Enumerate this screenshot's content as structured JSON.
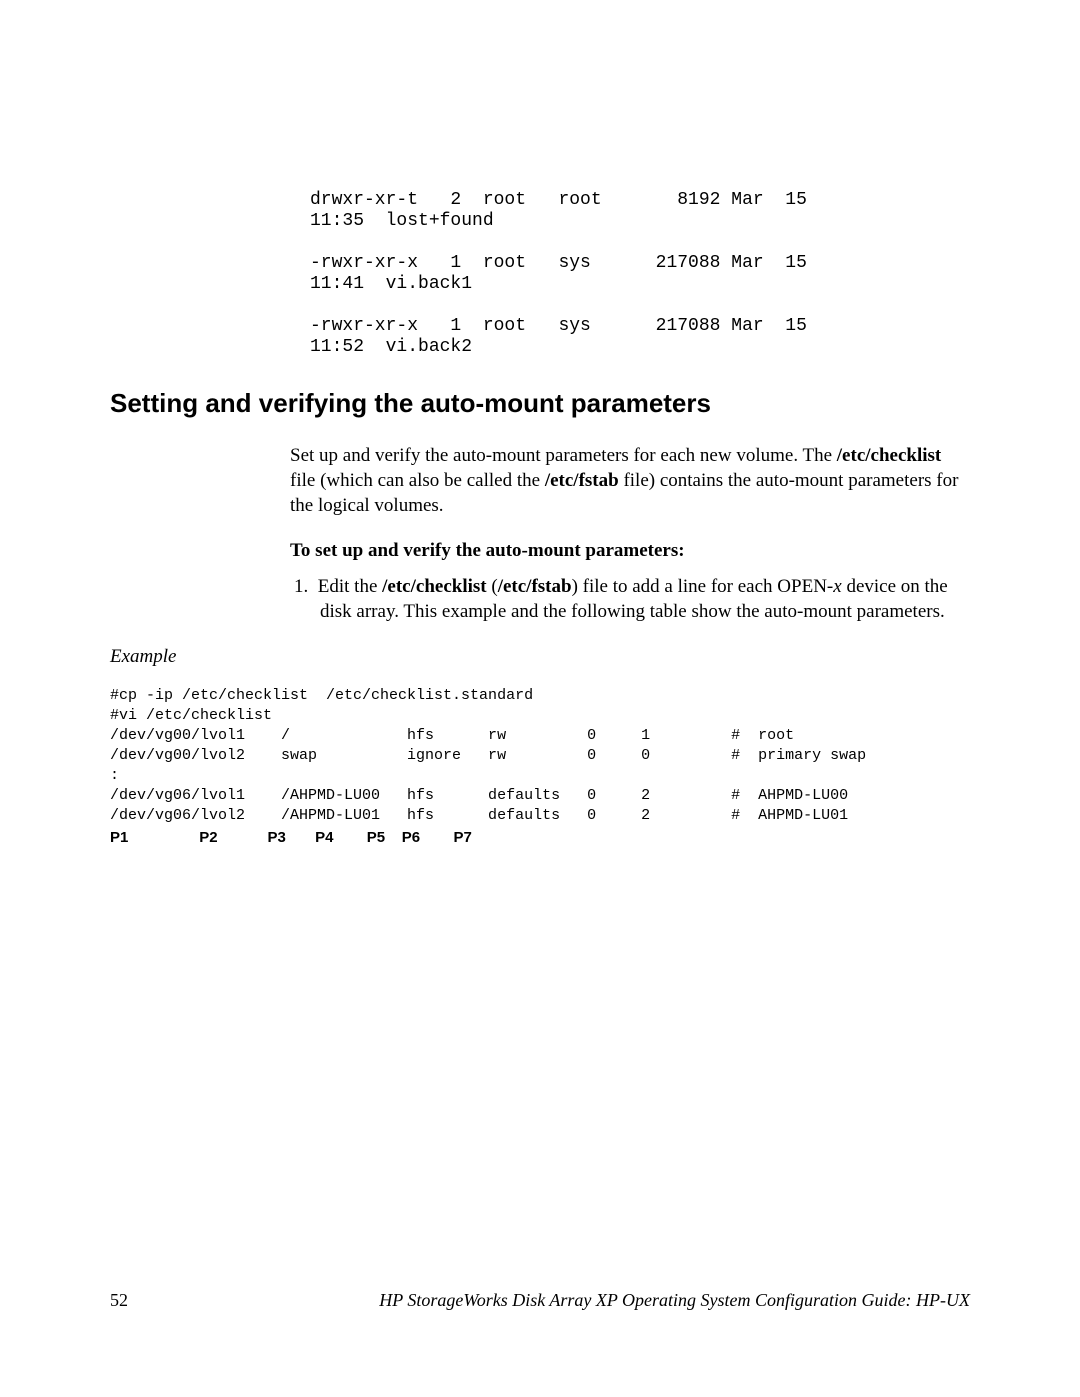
{
  "ls_output": "drwxr-xr-t   2  root   root       8192 Mar  15\n11:35  lost+found\n\n-rwxr-xr-x   1  root   sys      217088 Mar  15\n11:41  vi.back1\n\n-rwxr-xr-x   1  root   sys      217088 Mar  15\n11:52  vi.back2",
  "heading": "Setting and verifying the auto-mount parameters",
  "para_pre": "Set up and verify the auto-mount parameters for each new volume. The ",
  "para_b1": "/etc/checklist",
  "para_mid": " file (which can also be called the ",
  "para_b2": "/etc/fstab",
  "para_post": " file) contains the auto-mount parameters for the logical volumes.",
  "subhead": "To set up and verify the auto-mount parameters:",
  "step1_num": "1.",
  "step1_t1": "Edit the ",
  "step1_b1": "/etc/checklist",
  "step1_t2": " (",
  "step1_b2": "/etc/fstab",
  "step1_t3": ") file to add a line for each OPEN-",
  "step1_i1": "x",
  "step1_t4": " device on the disk array. This example and the following table show the auto-mount parameters.",
  "example_label": "Example",
  "checklist_text": "#cp -ip /etc/checklist  /etc/checklist.standard\n#vi /etc/checklist\n/dev/vg00/lvol1    /             hfs      rw         0     1         #  root\n/dev/vg00/lvol2    swap          ignore   rw         0     0         #  primary swap\n:\n/dev/vg06/lvol1    /AHPMD-LU00   hfs      defaults   0     2         #  AHPMD-LU00\n/dev/vg06/lvol2    /AHPMD-LU01   hfs      defaults   0     2         #  AHPMD-LU01",
  "param_legend": "P1                 P2            P3       P4        P5    P6        P7",
  "page_no": "52",
  "footer_title": "HP StorageWorks Disk Array XP Operating System Configuration Guide: HP-UX"
}
